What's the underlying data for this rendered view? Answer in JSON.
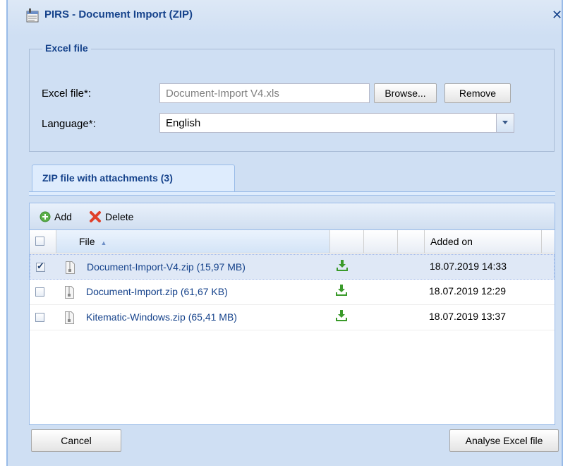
{
  "window": {
    "title": "PIRS - Document Import (ZIP)",
    "close_glyph": "✕"
  },
  "excel_section": {
    "legend": "Excel file",
    "excel_file_label": "Excel file*:",
    "excel_file_value": "Document-Import V4.xls",
    "browse_label": "Browse...",
    "remove_label": "Remove",
    "language_label": "Language*:",
    "language_value": "English"
  },
  "tab": {
    "label": "ZIP file with attachments (3)"
  },
  "toolbar": {
    "add_label": "Add",
    "delete_label": "Delete"
  },
  "grid": {
    "columns": {
      "file": "File",
      "added_on": "Added on"
    },
    "sort_glyph": "▲",
    "rows": [
      {
        "file": "Document-Import-V4.zip (15,97 MB)",
        "added_on": "18.07.2019 14:33",
        "checked": true
      },
      {
        "file": "Document-Import.zip (61,67 KB)",
        "added_on": "18.07.2019 12:29",
        "checked": false
      },
      {
        "file": "Kitematic-Windows.zip (65,41 MB)",
        "added_on": "18.07.2019 13:37",
        "checked": false
      }
    ]
  },
  "footer": {
    "cancel_label": "Cancel",
    "analyse_label": "Analyse Excel file"
  },
  "colors": {
    "accent": "#15428b",
    "frame": "#cfdff3",
    "border": "#99bbe8",
    "download_green": "#3a9a2a"
  }
}
